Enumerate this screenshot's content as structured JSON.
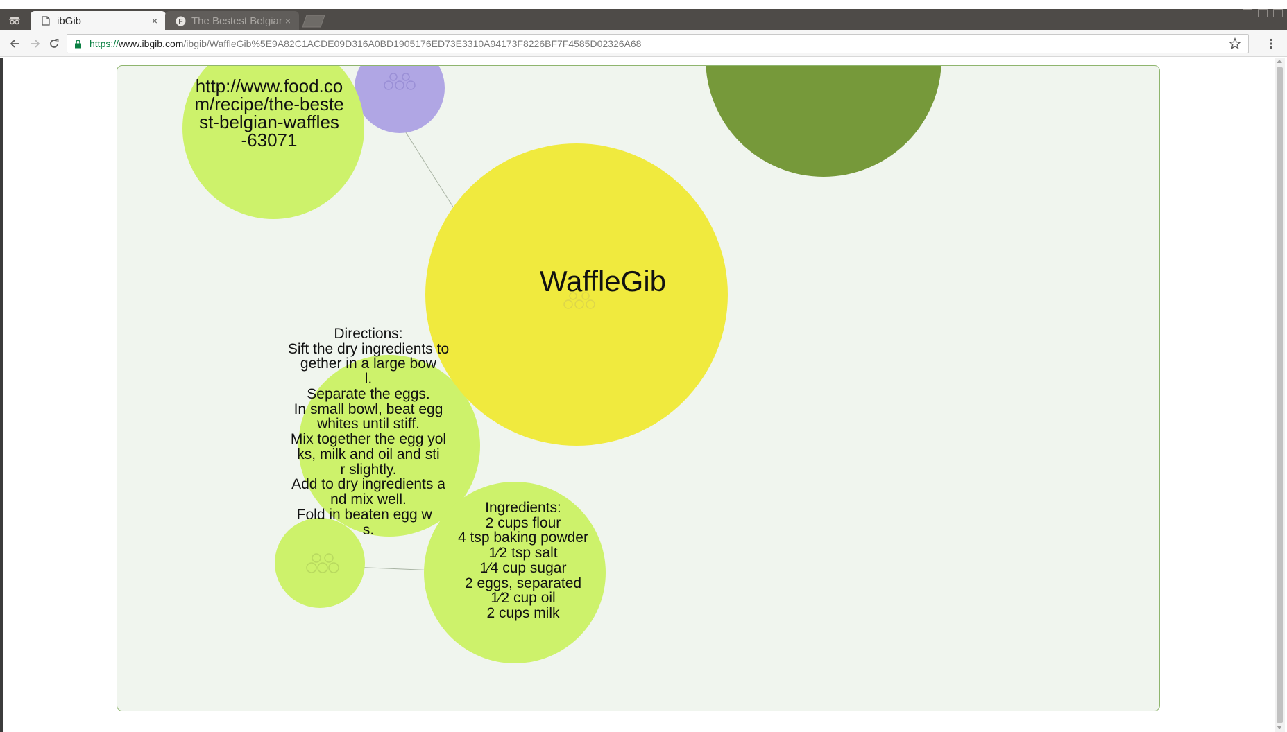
{
  "browser": {
    "tabs": [
      {
        "title": "ibGib",
        "favicon": "page-icon",
        "active": true
      },
      {
        "title": "The Bestest Belgian",
        "favicon": "food-com-icon",
        "active": false
      }
    ],
    "close_glyph": "×",
    "url": {
      "scheme": "https://",
      "host": "www.ibgib.com",
      "path": "/ibgib/WaffleGib%5E9A82C1ACDE09D316A0BD1905176ED73E3310A94173F8226BF7F4585D02326A68"
    }
  },
  "graph": {
    "nodes": {
      "url": {
        "text": "http://www.food.co\nm/recipe/the-beste\nst-belgian-waffles\n-63071",
        "color": "#cdf26b"
      },
      "root": {
        "text": "WaffleGib",
        "color": "#f0ea3e"
      },
      "directions": {
        "text": "Directions:\nSift the dry ingredients together in a large bow\nl.\nSeparate the eggs.\nIn small bowl, beat egg whites until stiff.\nMix together the egg yol\nks, milk and oil and sti\nr slightly.\nAdd to dry ingredients a\nnd mix well.\nFold in beaten egg w  \ns.",
        "color": "#cdf26b"
      },
      "ingredients": {
        "text": "Ingredients:\n2 cups flour\n4 tsp baking powder\n1⁄2 tsp salt\n1⁄4 cup sugar\n2 eggs, separated\n1⁄2 cup oil\n2 cups milk",
        "color": "#cdf26b"
      },
      "purple": {
        "color": "#b0a6e4"
      },
      "dark_green": {
        "color": "#76993a"
      },
      "small_green": {
        "color": "#cdf26b"
      }
    },
    "canvas_color": "#f0f5ee",
    "border_color": "#8fb56e"
  }
}
